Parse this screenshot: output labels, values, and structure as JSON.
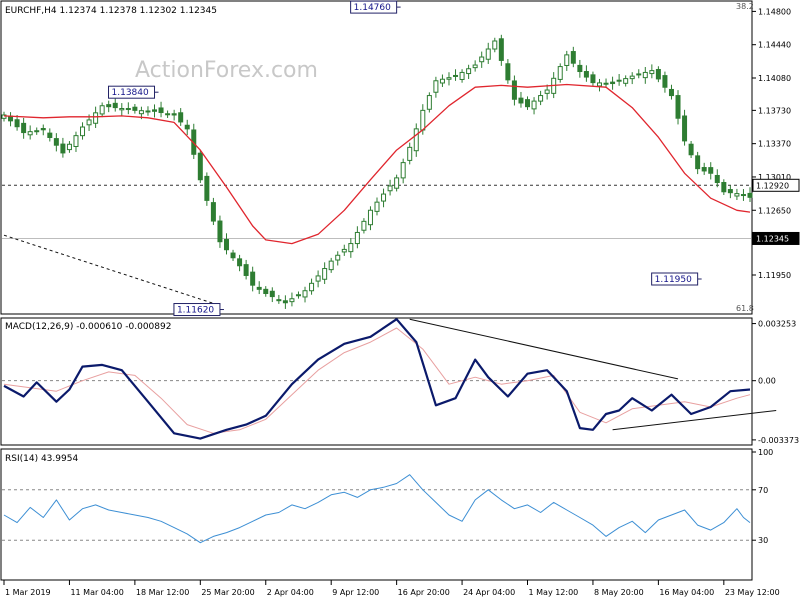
{
  "colors": {
    "background": "#ffffff",
    "panel_border": "#000000",
    "candle": "#2e7d32",
    "moving_average": "#e0262e",
    "macd_line": "#0b1a6b",
    "macd_signal": "#e8a0a0",
    "rsi_line": "#3d8fd4",
    "dashed_levels": "#555555",
    "trendlines": "#111111",
    "price_box_border": "#222266",
    "price_box_text": "#14148a",
    "current_price_box": "#000000",
    "watermark": "#c8c8c8"
  },
  "header": {
    "title": "EURCHF,H4  1.12374 1.12378 1.12302 1.12345",
    "watermark": "ActionForex.com",
    "fib_top": "38.2",
    "fib_bottom": "61.8"
  },
  "chart_data": [
    {
      "type": "line",
      "panel": "price",
      "title": "EURCHF,H4",
      "ohlc": {
        "open": 1.12374,
        "high": 1.12378,
        "low": 1.12302,
        "close": 1.12345
      },
      "ylim": [
        1.1155,
        1.1488
      ],
      "y_ticks": [
        1.148,
        1.1444,
        1.1408,
        1.1373,
        1.1337,
        1.1301,
        1.1265,
        1.1195
      ],
      "y_tick_labels": [
        "1.14800",
        "1.14440",
        "1.14080",
        "1.13730",
        "1.13370",
        "1.13010",
        "1.12650",
        "1.11950"
      ],
      "x_categories": [
        "1 Mar 2019",
        "11 Mar 04:00",
        "18 Mar 12:00",
        "25 Mar 20:00",
        "2 Apr 04:00",
        "9 Apr 12:00",
        "16 Apr 20:00",
        "24 Apr 04:00",
        "1 May 12:00",
        "8 May 20:00",
        "16 May 04:00",
        "23 May 12:00"
      ],
      "x_tick_index": [
        0,
        10,
        20,
        30,
        40,
        50,
        60,
        70,
        80,
        90,
        100,
        110
      ],
      "bar_count": 115,
      "series": [
        {
          "style": "candles",
          "x": [
            0,
            3,
            6,
            9,
            12,
            15,
            18,
            20,
            23,
            26,
            28,
            30,
            33,
            36,
            38,
            40,
            43,
            46,
            50,
            53,
            56,
            60,
            62,
            64,
            66,
            69,
            72,
            75,
            78,
            80,
            83,
            86,
            88,
            90,
            93,
            96,
            99,
            102,
            104,
            106,
            108,
            110,
            112,
            113,
            114
          ],
          "close": [
            1.1368,
            1.1349,
            1.1352,
            1.1327,
            1.1355,
            1.1378,
            1.1375,
            1.1373,
            1.1372,
            1.1368,
            1.1353,
            1.1298,
            1.1231,
            1.1205,
            1.1184,
            1.1175,
            1.1165,
            1.1178,
            1.121,
            1.1229,
            1.1265,
            1.13,
            1.1333,
            1.1373,
            1.1405,
            1.141,
            1.1422,
            1.1448,
            1.1385,
            1.1377,
            1.1395,
            1.1433,
            1.1415,
            1.1403,
            1.1402,
            1.141,
            1.1416,
            1.1389,
            1.134,
            1.131,
            1.1305,
            1.1285,
            1.1283,
            1.1282,
            1.1279
          ]
        },
        {
          "name": "",
          "style": "moving-average",
          "x": [
            0,
            6,
            10,
            14,
            18,
            22,
            26,
            30,
            34,
            38,
            40,
            44,
            48,
            52,
            56,
            60,
            64,
            68,
            72,
            76,
            80,
            86,
            92,
            96,
            100,
            104,
            108,
            112,
            114
          ],
          "values": [
            1.1367,
            1.1365,
            1.1366,
            1.1366,
            1.1367,
            1.1365,
            1.136,
            1.133,
            1.129,
            1.1248,
            1.1233,
            1.1229,
            1.1239,
            1.1265,
            1.1298,
            1.133,
            1.1352,
            1.1378,
            1.1398,
            1.14,
            1.1398,
            1.1401,
            1.1398,
            1.1376,
            1.1344,
            1.1305,
            1.1278,
            1.1265,
            1.1263
          ]
        }
      ],
      "levels": [
        {
          "value": 1.1292,
          "label": "1.12920",
          "style": "dashed"
        },
        {
          "value": 1.12345,
          "label": "1.12345",
          "style": "current"
        }
      ],
      "annotations": [
        {
          "x": 23,
          "value": 1.1384,
          "label": "1.13840"
        },
        {
          "x": 60,
          "value": 1.1476,
          "label": "1.14760"
        },
        {
          "x": 33,
          "value": 1.1162,
          "label": "1.11620"
        },
        {
          "x": 106,
          "value": 1.1195,
          "label": "1.11950"
        }
      ],
      "trendlines": [
        {
          "x": [
            0,
            33
          ],
          "values": [
            1.1238,
            1.1162
          ],
          "style": "dashed"
        }
      ]
    },
    {
      "type": "line",
      "panel": "macd",
      "title": "MACD(12,26,9) -0.000610 -0.000892",
      "ylim": [
        -0.00355,
        0.0034
      ],
      "y_ticks": [
        0.003253,
        0.0,
        -0.003373
      ],
      "y_tick_labels": [
        "0.003253",
        "0.00",
        "-0.003373"
      ],
      "series": [
        {
          "name": "",
          "style": "macd-line",
          "x": [
            0,
            3,
            5,
            8,
            10,
            12,
            15,
            18,
            22,
            26,
            30,
            34,
            37,
            40,
            44,
            48,
            52,
            56,
            60,
            63,
            66,
            69,
            72,
            74,
            77,
            80,
            83,
            86,
            88,
            90,
            92,
            94,
            96,
            99,
            102,
            105,
            108,
            111,
            114
          ],
          "values": [
            -0.0003,
            -0.0009,
            -0.0001,
            -0.0012,
            -0.0005,
            0.0008,
            0.0009,
            0.0006,
            -0.0012,
            -0.003,
            -0.0033,
            -0.0028,
            -0.0025,
            -0.002,
            -0.0002,
            0.0012,
            0.0021,
            0.0025,
            0.0035,
            0.0022,
            -0.0014,
            -0.001,
            0.0012,
            0.0002,
            -0.0009,
            0.0004,
            0.0006,
            -0.0006,
            -0.0027,
            -0.0028,
            -0.0019,
            -0.0017,
            -0.001,
            -0.0017,
            -0.0008,
            -0.0019,
            -0.0015,
            -0.0006,
            -0.0005
          ]
        },
        {
          "name": "",
          "style": "signal-line",
          "x": [
            0,
            4,
            8,
            12,
            16,
            20,
            24,
            28,
            32,
            36,
            40,
            44,
            48,
            52,
            56,
            60,
            64,
            68,
            72,
            76,
            80,
            84,
            88,
            92,
            96,
            100,
            104,
            108,
            112,
            114
          ],
          "values": [
            -0.0002,
            -0.0004,
            -0.0006,
            0.0,
            0.0005,
            0.0003,
            -0.001,
            -0.0025,
            -0.003,
            -0.0028,
            -0.0022,
            -0.0008,
            0.0006,
            0.0016,
            0.0022,
            0.003,
            0.0018,
            -0.0002,
            0.0002,
            -0.0002,
            0.0,
            0.0003,
            -0.0018,
            -0.0024,
            -0.0016,
            -0.0014,
            -0.0012,
            -0.0015,
            -0.001,
            -0.0008
          ]
        }
      ],
      "trendlines": [
        {
          "x": [
            62,
            103
          ],
          "values": [
            0.0035,
            0.0001
          ],
          "style": "solid"
        },
        {
          "x": [
            93,
            118
          ],
          "values": [
            -0.0028,
            -0.0017
          ],
          "style": "solid"
        }
      ]
    },
    {
      "type": "line",
      "panel": "rsi",
      "title": "RSI(14) 43.9954",
      "ylim": [
        0,
        100
      ],
      "y_ticks": [
        100,
        70,
        30
      ],
      "y_tick_labels": [
        "100",
        "70",
        "30"
      ],
      "levels": [
        {
          "value": 70,
          "style": "dashed"
        },
        {
          "value": 30,
          "style": "dashed"
        }
      ],
      "series": [
        {
          "name": "",
          "style": "rsi-line",
          "x": [
            0,
            2,
            4,
            6,
            8,
            10,
            12,
            14,
            16,
            18,
            20,
            22,
            24,
            26,
            28,
            30,
            32,
            34,
            36,
            38,
            40,
            42,
            44,
            46,
            48,
            50,
            52,
            54,
            56,
            58,
            60,
            62,
            64,
            66,
            68,
            70,
            72,
            74,
            76,
            78,
            80,
            82,
            84,
            86,
            88,
            90,
            92,
            94,
            96,
            98,
            100,
            102,
            104,
            106,
            108,
            110,
            112,
            113,
            114
          ],
          "values": [
            50,
            44,
            56,
            48,
            62,
            46,
            55,
            58,
            54,
            52,
            50,
            48,
            45,
            40,
            35,
            28,
            33,
            36,
            40,
            45,
            50,
            52,
            58,
            55,
            60,
            66,
            68,
            64,
            70,
            72,
            75,
            82,
            70,
            60,
            50,
            45,
            62,
            70,
            62,
            55,
            58,
            52,
            60,
            54,
            48,
            42,
            33,
            40,
            45,
            36,
            46,
            50,
            54,
            42,
            38,
            44,
            55,
            48,
            44
          ]
        }
      ]
    }
  ]
}
